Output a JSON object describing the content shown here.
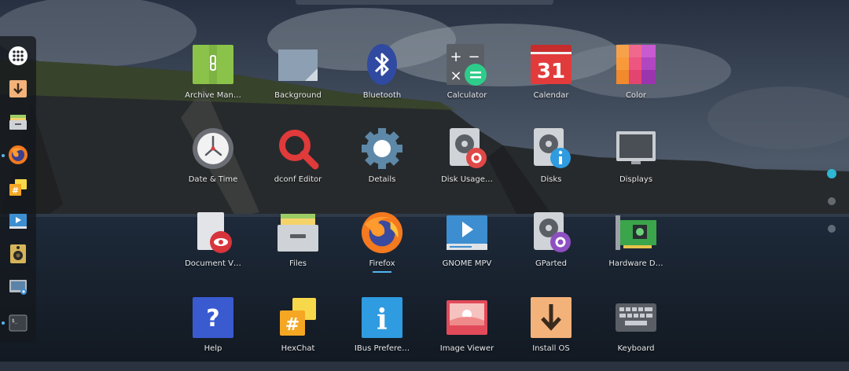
{
  "apps": [
    {
      "label": "Archive Man…",
      "icon": "archive-manager-icon"
    },
    {
      "label": "Background",
      "icon": "background-icon"
    },
    {
      "label": "Bluetooth",
      "icon": "bluetooth-icon"
    },
    {
      "label": "Calculator",
      "icon": "calculator-icon"
    },
    {
      "label": "Calendar",
      "icon": "calendar-icon",
      "day": "31"
    },
    {
      "label": "Color",
      "icon": "color-icon"
    },
    {
      "label": "Date & Time",
      "icon": "clock-icon"
    },
    {
      "label": "dconf Editor",
      "icon": "dconf-editor-icon"
    },
    {
      "label": "Details",
      "icon": "details-gear-icon"
    },
    {
      "label": "Disk Usage…",
      "icon": "disk-usage-icon"
    },
    {
      "label": "Disks",
      "icon": "disks-icon"
    },
    {
      "label": "Displays",
      "icon": "displays-icon"
    },
    {
      "label": "Document V…",
      "icon": "document-viewer-icon"
    },
    {
      "label": "Files",
      "icon": "files-icon"
    },
    {
      "label": "Firefox",
      "icon": "firefox-icon",
      "running": true
    },
    {
      "label": "GNOME MPV",
      "icon": "gnome-mpv-icon"
    },
    {
      "label": "GParted",
      "icon": "gparted-icon"
    },
    {
      "label": "Hardware D…",
      "icon": "hardware-drivers-icon"
    },
    {
      "label": "Help",
      "icon": "help-icon",
      "glyph": "?"
    },
    {
      "label": "HexChat",
      "icon": "hexchat-icon",
      "glyph": "#"
    },
    {
      "label": "IBus Prefere…",
      "icon": "ibus-preferences-icon",
      "glyph": "i"
    },
    {
      "label": "Image Viewer",
      "icon": "image-viewer-icon"
    },
    {
      "label": "Install OS",
      "icon": "install-os-icon"
    },
    {
      "label": "Keyboard",
      "icon": "keyboard-icon"
    }
  ],
  "dash": [
    {
      "icon": "show-applications-icon"
    },
    {
      "icon": "install-os-icon"
    },
    {
      "icon": "files-icon"
    },
    {
      "icon": "firefox-icon",
      "running": true
    },
    {
      "icon": "hexchat-icon",
      "glyph": "#"
    },
    {
      "icon": "gnome-mpv-icon"
    },
    {
      "icon": "speaker-icon"
    },
    {
      "icon": "screenshot-icon"
    },
    {
      "icon": "terminal-icon",
      "running": true,
      "glyph": "$_"
    }
  ],
  "pages": {
    "count": 3,
    "current": 1
  },
  "colors": {
    "accent": "#54b4f0",
    "label": "#e8eaec",
    "dash_bg": "#14181e"
  }
}
